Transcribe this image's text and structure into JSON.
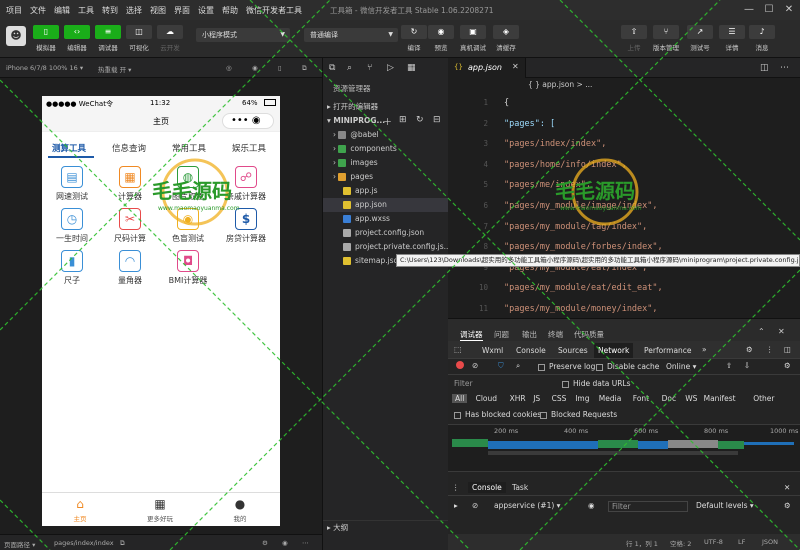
{
  "menu": {
    "items": [
      "项目",
      "文件",
      "编辑",
      "工具",
      "转到",
      "选择",
      "视图",
      "界面",
      "设置",
      "帮助",
      "微信开发者工具"
    ],
    "window_title": "工具箱 - 微信开发者工具 Stable 1.06.2208271"
  },
  "toolbar": {
    "left_buttons": [
      "模拟器",
      "编辑器",
      "调试器",
      "可视化",
      "云开发"
    ],
    "mode_select": "小程序模式",
    "compile_select": "普通编译",
    "mid_buttons": [
      "编译",
      "预览",
      "真机调试",
      "清缓存"
    ],
    "right_buttons": [
      "上传",
      "版本管理",
      "测试号",
      "详情",
      "消息"
    ]
  },
  "simulator": {
    "device": "iPhone 6/7/8 100% 16 ▾",
    "hotreload": "热重载 开 ▾",
    "status": {
      "carrier": "●●●●● WeChat令",
      "time": "11:32",
      "battery": "64%"
    },
    "page_title": "主页",
    "capsule": "•••  ◉",
    "tabs": [
      "测算工具",
      "信息查询",
      "常用工具",
      "娱乐工具"
    ],
    "tools": [
      {
        "label": "网速测试",
        "icon": "▤",
        "color": "#3a8fd6"
      },
      {
        "label": "计算器",
        "icon": "▦",
        "color": "#f08a24"
      },
      {
        "label": "图片取色",
        "icon": "◍",
        "color": "#2d9c3c"
      },
      {
        "label": "亲戚计算器",
        "icon": "☍",
        "color": "#e04a8a"
      },
      {
        "label": "一生时间",
        "icon": "◷",
        "color": "#3a8fd6"
      },
      {
        "label": "尺码计算",
        "icon": "✂",
        "color": "#e84a4a"
      },
      {
        "label": "色盲测试",
        "icon": "◉",
        "color": "#f0b020"
      },
      {
        "label": "房贷计算器",
        "icon": "$",
        "color": "#1e5aa8"
      },
      {
        "label": "尺子",
        "icon": "▮",
        "color": "#3a8fd6"
      },
      {
        "label": "量角器",
        "icon": "◠",
        "color": "#3a8fd6"
      },
      {
        "label": "BMI计算器",
        "icon": "◘",
        "color": "#e04a8a"
      }
    ],
    "bottom_tabs": [
      "主页",
      "更多好玩",
      "我的"
    ]
  },
  "pathbar": {
    "label": "页面路径 ▾",
    "path": "pages/index/index"
  },
  "explorer": {
    "title": "资源管理器",
    "open_editors": "打开的编辑器",
    "project": "MINIPROG...",
    "items": [
      {
        "name": "@babel",
        "type": "folder",
        "color": "#888"
      },
      {
        "name": "components",
        "type": "folder",
        "color": "#3fa34d"
      },
      {
        "name": "images",
        "type": "folder",
        "color": "#3fa34d"
      },
      {
        "name": "pages",
        "type": "folder",
        "color": "#e0a030"
      },
      {
        "name": "app.js",
        "type": "file",
        "color": "#e0c030"
      },
      {
        "name": "app.json",
        "type": "file",
        "color": "#e0c030"
      },
      {
        "name": "app.wxss",
        "type": "file",
        "color": "#3a7fd6"
      },
      {
        "name": "project.config.json",
        "type": "file",
        "color": "#aaa"
      },
      {
        "name": "project.private.config.js...",
        "type": "file",
        "color": "#aaa"
      },
      {
        "name": "sitemap.json",
        "type": "file",
        "color": "#e0c030"
      }
    ],
    "outline": "大纲"
  },
  "editor": {
    "tab": "app.json",
    "breadcrumb": "{ } app.json > ...",
    "line_numbers": [
      "1",
      "2",
      "3",
      "4",
      "5",
      "6",
      "7",
      "8",
      "9",
      "10",
      "11",
      "12",
      "13",
      "14"
    ],
    "lines": [
      "{",
      "  \"pages\": [",
      "    \"pages/index/index\",",
      "    \"pages/home/info/index\",",
      "    \"pages/me/index\",",
      "    \"pages/my_module/image/index\",",
      "    \"pages/my_module/tag/index\",",
      "    \"pages/my_module/forbes/index\",",
      "    \"pages/my_module/eat/index\",",
      "    \"pages/my_module/eat/edit_eat\",",
      "    \"pages/my_module/money/index\","
    ],
    "tooltip": "C:\\Users\\123\\Downloads\\超实用的多功能工具箱小程序源码\\超实用的多功能工具箱小程序源码\\miniprogram\\project.private.config.json"
  },
  "devtools": {
    "top_tabs": [
      "调试器",
      "问题",
      "输出",
      "终端",
      "代码质量"
    ],
    "panel_tabs": [
      "Wxml",
      "Console",
      "Sources",
      "Network",
      "Performance"
    ],
    "active_panel": "Network",
    "toolbar": {
      "preserve_log": "Preserve log",
      "disable_cache": "Disable cache",
      "online": "Online"
    },
    "filter_label": "Filter",
    "hide_data_urls": "Hide data URLs",
    "types": [
      "All",
      "Cloud",
      "XHR",
      "JS",
      "CSS",
      "Img",
      "Media",
      "Font",
      "Doc",
      "WS",
      "Manifest",
      "Other"
    ],
    "has_blocked": "Has blocked cookies",
    "blocked_requests": "Blocked Requests",
    "timeline_ticks": [
      "200 ms",
      "400 ms",
      "600 ms",
      "800 ms",
      "1000 ms"
    ],
    "console_tabs": [
      "Console",
      "Task"
    ],
    "context": "appservice (#1)",
    "console_filter": "Filter",
    "levels": "Default levels"
  },
  "statusline": {
    "position": "行 1，列 1",
    "spaces": "空格: 2",
    "encoding": "UTF-8",
    "eol": "LF",
    "lang": "JSON"
  },
  "watermark": {
    "brand": "毛毛源码",
    "url": "www.maomaoyuanma.com"
  }
}
